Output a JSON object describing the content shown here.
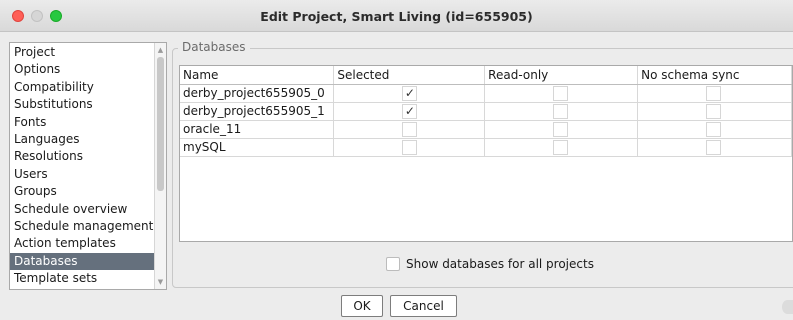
{
  "window": {
    "title": "Edit Project, Smart Living (id=655905)"
  },
  "sidebar": {
    "items": [
      {
        "label": "Project"
      },
      {
        "label": "Options"
      },
      {
        "label": "Compatibility"
      },
      {
        "label": "Substitutions"
      },
      {
        "label": "Fonts"
      },
      {
        "label": "Languages"
      },
      {
        "label": "Resolutions"
      },
      {
        "label": "Users"
      },
      {
        "label": "Groups"
      },
      {
        "label": "Schedule overview"
      },
      {
        "label": "Schedule management"
      },
      {
        "label": "Action templates"
      },
      {
        "label": "Databases"
      },
      {
        "label": "Template sets"
      }
    ],
    "selected": "Databases"
  },
  "databases": {
    "group_title": "Databases",
    "columns": [
      "Name",
      "Selected",
      "Read-only",
      "No schema sync"
    ],
    "rows": [
      {
        "name": "derby_project655905_0",
        "selected": true,
        "read_only": false,
        "no_schema_sync": false
      },
      {
        "name": "derby_project655905_1",
        "selected": true,
        "read_only": false,
        "no_schema_sync": false
      },
      {
        "name": "oracle_11",
        "selected": false,
        "read_only": false,
        "no_schema_sync": false
      },
      {
        "name": "mySQL",
        "selected": false,
        "read_only": false,
        "no_schema_sync": false
      }
    ],
    "check_glyph": "✓",
    "show_all_label": "Show databases for all projects",
    "show_all_checked": false
  },
  "buttons": {
    "ok": "OK",
    "cancel": "Cancel"
  },
  "colors": {
    "selection": "#65707d",
    "close": "#ff5f57",
    "zoom": "#28c840"
  }
}
